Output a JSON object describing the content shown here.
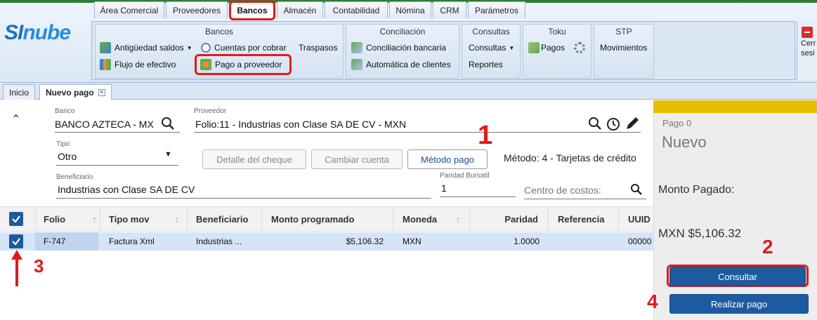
{
  "logo": {
    "part1": "SI",
    "part2": "nube"
  },
  "tabs": [
    "Área Comercial",
    "Proveedores",
    "Bancos",
    "Almacén",
    "Contabilidad",
    "Nómina",
    "CRM",
    "Parámetros"
  ],
  "ribbon": {
    "groups": {
      "bancos": "Bancos",
      "conciliacion": "Conciliación",
      "consultas": "Consultas",
      "toku": "Toku",
      "stp": "STP"
    },
    "antiguedad": "Antigüedad saldos",
    "cuentas": "Cuentas por cobrar",
    "traspasos": "Traspasos",
    "flujo": "Flujo de efectivo",
    "pago_proveedor": "Pago a proveedor",
    "conciliacion_bancaria": "Conciliación bancaria",
    "automatica": "Automática de clientes",
    "consultas": "Consultas",
    "reportes": "Reportes",
    "pagos": "Pagos",
    "movimientos": "Movimientos",
    "cerrar1": "Cerr",
    "cerrar2": "sesi"
  },
  "doc_tabs": {
    "inicio": "Inicio",
    "nuevo_pago": "Nuevo pago"
  },
  "form": {
    "banco_label": "Banco",
    "banco_value": "BANCO AZTECA - MX",
    "proveedor_label": "Proveedor",
    "proveedor_value": "Folio:11 - Industrias con Clase SA DE CV - MXN",
    "tipo_label": "Tipo",
    "tipo_value": "Otro",
    "btn_detalle": "Detalle del cheque",
    "btn_cambiar": "Cambiar cuenta",
    "btn_metodo": "Método pago",
    "metodo_text": "Método: 4 - Tarjetas de crédito",
    "beneficiario_label": "Beneficiario",
    "beneficiario_value": "Industrias con Clase SA DE CV",
    "paridad_label": "Paridad Bursatil",
    "paridad_value": "1",
    "centro_placeholder": "Centro de costos:"
  },
  "grid": {
    "headers": [
      "Folio",
      "Tipo mov",
      "Beneficiario",
      "Monto programado",
      "Moneda",
      "Paridad",
      "Referencia",
      "UUID"
    ],
    "row": {
      "folio": "F-747",
      "tipo": "Factura Xml",
      "beneficiario": "Industrias ...",
      "monto": "$5,106.32",
      "moneda": "MXN",
      "paridad": "1.0000",
      "referencia": "",
      "uuid": "00000"
    }
  },
  "side": {
    "pago_label": "Pago 0",
    "status": "Nuevo",
    "monto_label": "Monto Pagado:",
    "monto_value": "MXN $5,106.32",
    "btn_consultar": "Consultar",
    "btn_realizar": "Realizar pago"
  },
  "steps": [
    "1",
    "2",
    "3",
    "4"
  ],
  "colors": {
    "accent": "#1e5aa0",
    "highlight": "#e01b1b",
    "yellow": "#e6c000"
  }
}
